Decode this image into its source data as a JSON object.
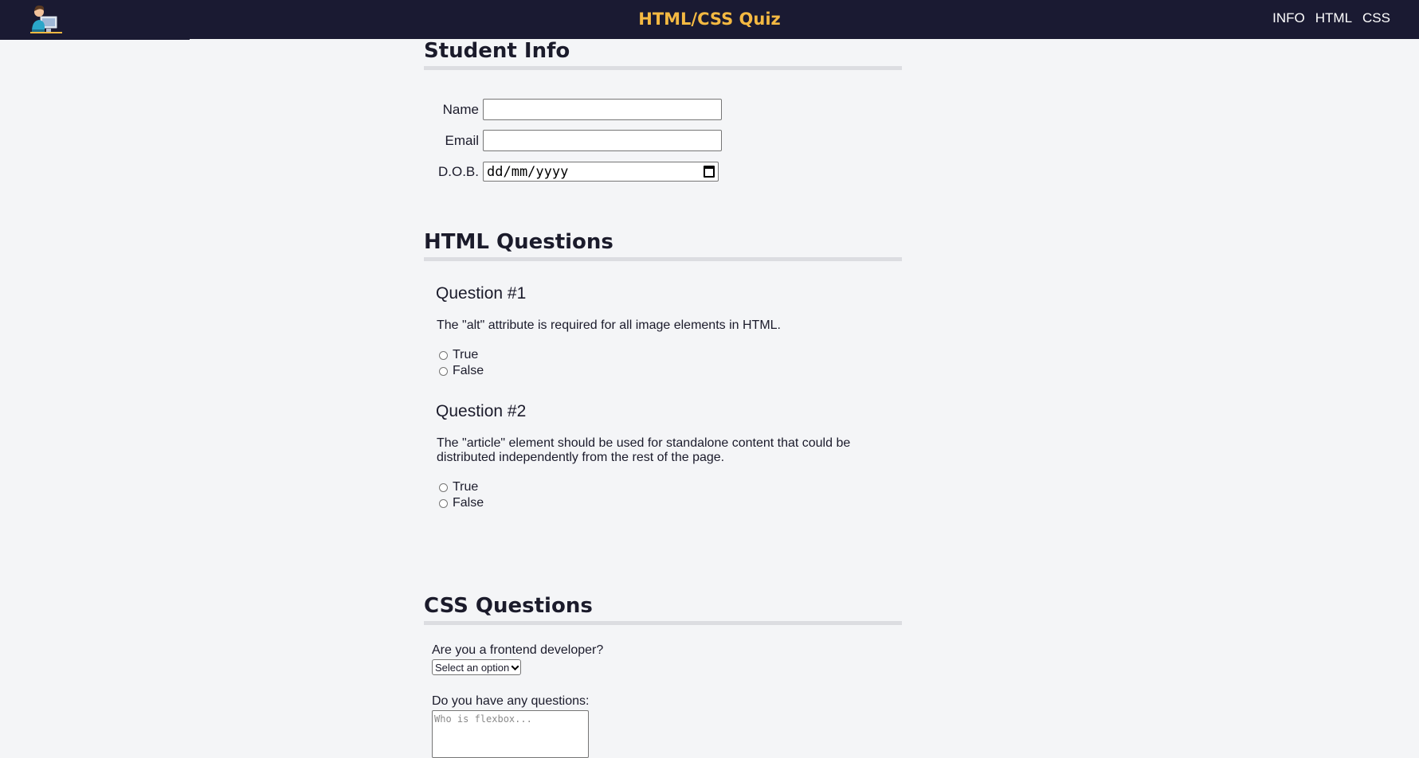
{
  "header": {
    "logo_icon": "developer-avatar-icon",
    "title": "HTML/CSS Quiz",
    "nav": [
      "INFO",
      "HTML",
      "CSS"
    ]
  },
  "student_info": {
    "title": "Student Info",
    "name_label": "Name",
    "name_value": "",
    "email_label": "Email",
    "email_value": "",
    "dob_label": "D.O.B.",
    "dob_placeholder": "dd/mm/yyyy"
  },
  "html_questions": {
    "title": "HTML Questions",
    "questions": [
      {
        "title": "Question #1",
        "text": "The \"alt\" attribute is required for all image elements in HTML.",
        "options": [
          "True",
          "False"
        ]
      },
      {
        "title": "Question #2",
        "text": "The \"article\" element should be used for standalone content that could be distributed independently from the rest of the page.",
        "options": [
          "True",
          "False"
        ]
      }
    ]
  },
  "css_questions": {
    "title": "CSS Questions",
    "frontend_label": "Are you a frontend developer?",
    "frontend_selected": "Select an option",
    "questions_label": "Do you have any questions:",
    "questions_placeholder": "Who is flexbox..."
  },
  "colors": {
    "header_bg": "#1a1a32",
    "title_color": "#f4b942",
    "page_bg": "#f4f5f7"
  }
}
